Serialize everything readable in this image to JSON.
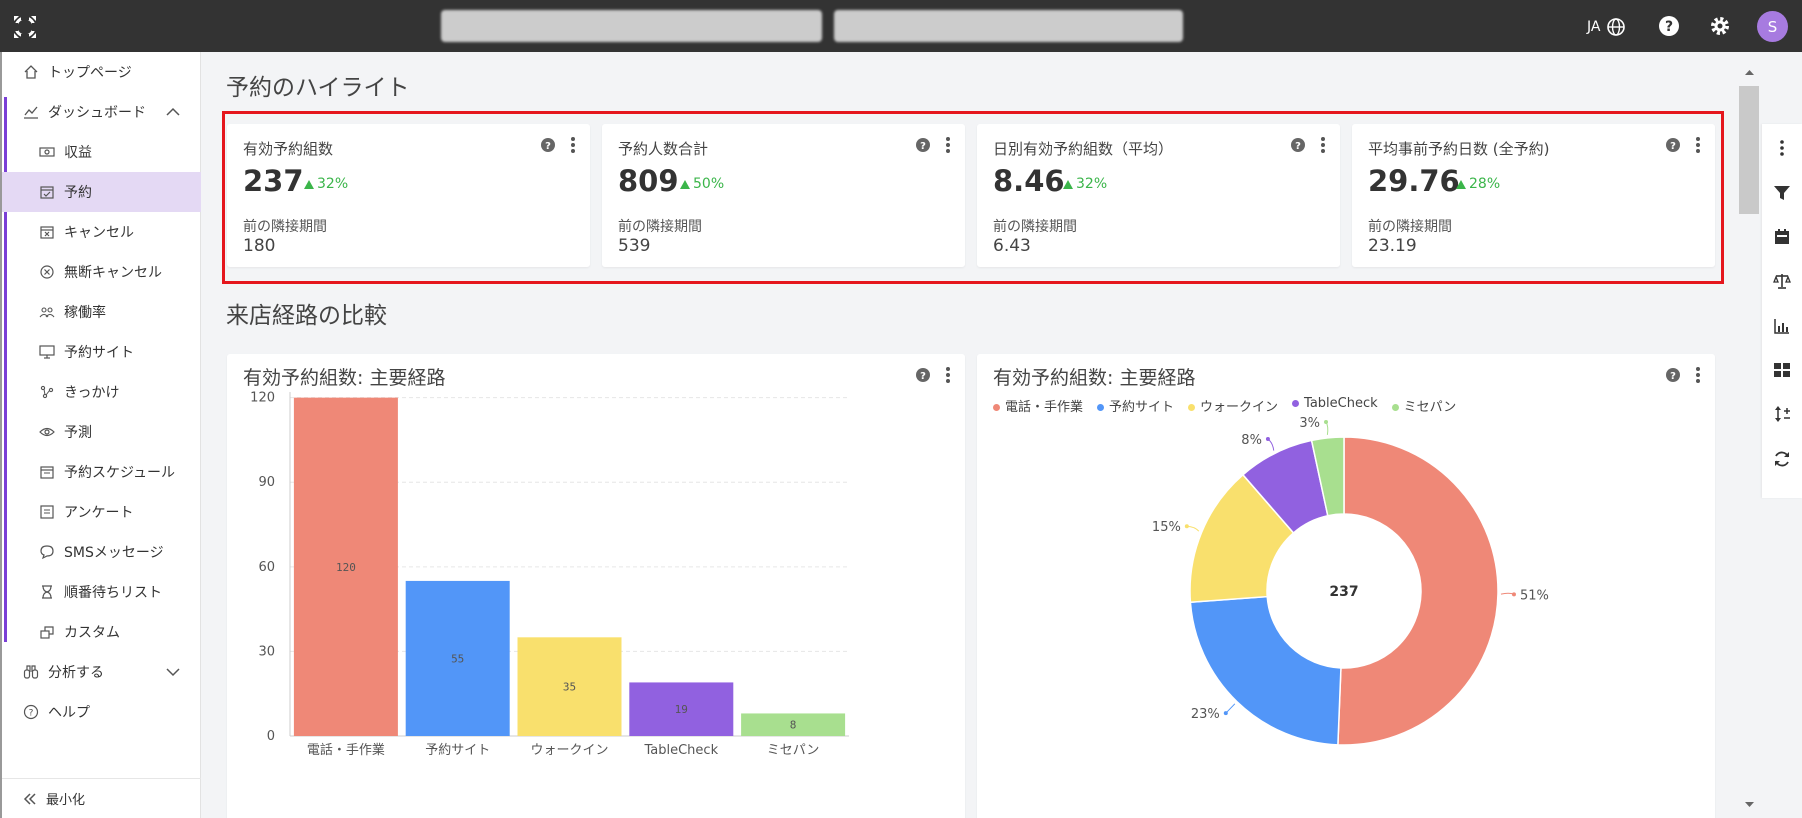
{
  "topbar": {
    "lang": "JA",
    "avatar_letter": "S"
  },
  "sidebar": {
    "items": [
      {
        "label": "トップページ",
        "icon": "home-icon"
      },
      {
        "label": "ダッシュボード",
        "icon": "chart-line-icon"
      },
      {
        "label": "収益",
        "icon": "money-icon"
      },
      {
        "label": "予約",
        "icon": "calendar-check-icon"
      },
      {
        "label": "キャンセル",
        "icon": "calendar-x-icon"
      },
      {
        "label": "無断キャンセル",
        "icon": "circle-x-icon"
      },
      {
        "label": "稼働率",
        "icon": "people-icon"
      },
      {
        "label": "予約サイト",
        "icon": "monitor-icon"
      },
      {
        "label": "きっかけ",
        "icon": "nodes-icon"
      },
      {
        "label": "予測",
        "icon": "eye-icon"
      },
      {
        "label": "予約スケジュール",
        "icon": "calendar-icon"
      },
      {
        "label": "アンケート",
        "icon": "form-icon"
      },
      {
        "label": "SMSメッセージ",
        "icon": "chat-icon"
      },
      {
        "label": "順番待ちリスト",
        "icon": "hourglass-icon"
      },
      {
        "label": "カスタム",
        "icon": "custom-icon"
      },
      {
        "label": "分析する",
        "icon": "binoculars-icon"
      },
      {
        "label": "ヘルプ",
        "icon": "help-circle-icon"
      }
    ],
    "minimize_label": "最小化"
  },
  "main": {
    "highlight_title": "予約のハイライト",
    "compare_title": "来店経路の比較",
    "kpis": [
      {
        "label": "有効予約組数",
        "value": "237",
        "delta": "32%",
        "prev_label": "前の隣接期間",
        "prev_value": "180"
      },
      {
        "label": "予約人数合計",
        "value": "809",
        "delta": "50%",
        "prev_label": "前の隣接期間",
        "prev_value": "539"
      },
      {
        "label": "日別有効予約組数（平均）",
        "value": "8.46",
        "delta": "32%",
        "prev_label": "前の隣接期間",
        "prev_value": "6.43"
      },
      {
        "label": "平均事前予約日数 (全予約)",
        "value": "29.76",
        "delta": "28%",
        "prev_label": "前の隣接期間",
        "prev_value": "23.19"
      }
    ],
    "bar_card_title": "有効予約組数: 主要経路",
    "donut_card_title": "有効予約組数: 主要経路"
  },
  "colors": {
    "phone": "#ef8877",
    "site": "#5296f8",
    "walkin": "#f9e06d",
    "tablecheck": "#9161e0",
    "misepan": "#a8df8f",
    "accent": "#7a3fd6",
    "highlight_border": "#e5161d"
  },
  "chart_data": [
    {
      "type": "bar",
      "title": "有効予約組数: 主要経路",
      "categories": [
        "電話・手作業",
        "予約サイト",
        "ウォークイン",
        "TableCheck",
        "ミセパン"
      ],
      "values": [
        120,
        55,
        35,
        19,
        8
      ],
      "yticks": [
        0,
        30,
        60,
        90,
        120
      ],
      "ylim": [
        0,
        122
      ],
      "grid": true
    },
    {
      "type": "pie",
      "title": "有効予約組数: 主要経路",
      "center_label": "237",
      "labels": [
        "電話・手作業",
        "予約サイト",
        "ウォークイン",
        "TableCheck",
        "ミセパン"
      ],
      "percent_labels": [
        "51%",
        "23%",
        "15%",
        "8%",
        "3%"
      ],
      "values": [
        120,
        55,
        35,
        19,
        8
      ],
      "legend": "top-left"
    }
  ]
}
